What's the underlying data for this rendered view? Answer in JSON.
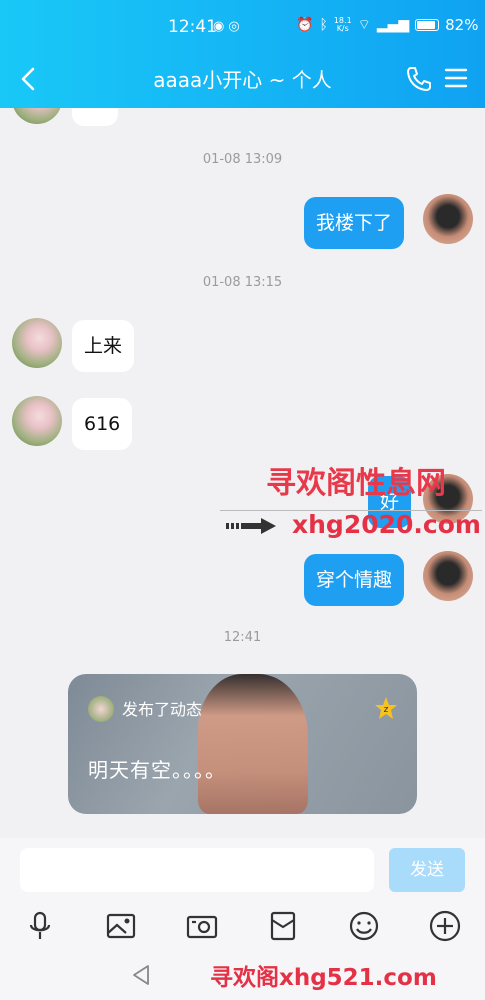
{
  "status_bar": {
    "time": "12:41",
    "speed_top": "18.1",
    "speed_bottom": "K/s",
    "battery": "82%"
  },
  "header": {
    "title": "aaaa小开心 ~ 个人",
    "back_icon": "back-arrow-icon",
    "call_icon": "phone-icon",
    "menu_icon": "menu-icon"
  },
  "messages": [
    {
      "type": "timestamp",
      "text": "01-08 13:09"
    },
    {
      "type": "outgoing",
      "text": "我楼下了"
    },
    {
      "type": "timestamp",
      "text": "01-08 13:15"
    },
    {
      "type": "incoming",
      "text": "上来"
    },
    {
      "type": "incoming",
      "text": "616"
    },
    {
      "type": "outgoing",
      "text": "好"
    },
    {
      "type": "outgoing",
      "text": "穿个情趣"
    },
    {
      "type": "timestamp",
      "text": "12:41"
    }
  ],
  "feed_card": {
    "action": "发布了动态",
    "content": "明天有空。。。。"
  },
  "watermarks": {
    "top": "寻欢阁性息网",
    "middle": "xhg2020.com",
    "bottom": "寻欢阁xhg521.com"
  },
  "input": {
    "value": "",
    "send_label": "发送"
  },
  "toolbar_icons": [
    "microphone-icon",
    "image-icon",
    "camera-icon",
    "red-packet-icon",
    "emoji-icon",
    "plus-icon"
  ],
  "colors": {
    "header_start": "#19c8f7",
    "header_end": "#0fa2f2",
    "outgoing_bubble": "#1e9ff2",
    "send_button": "#a9dbfb",
    "watermark": "#e53145"
  }
}
